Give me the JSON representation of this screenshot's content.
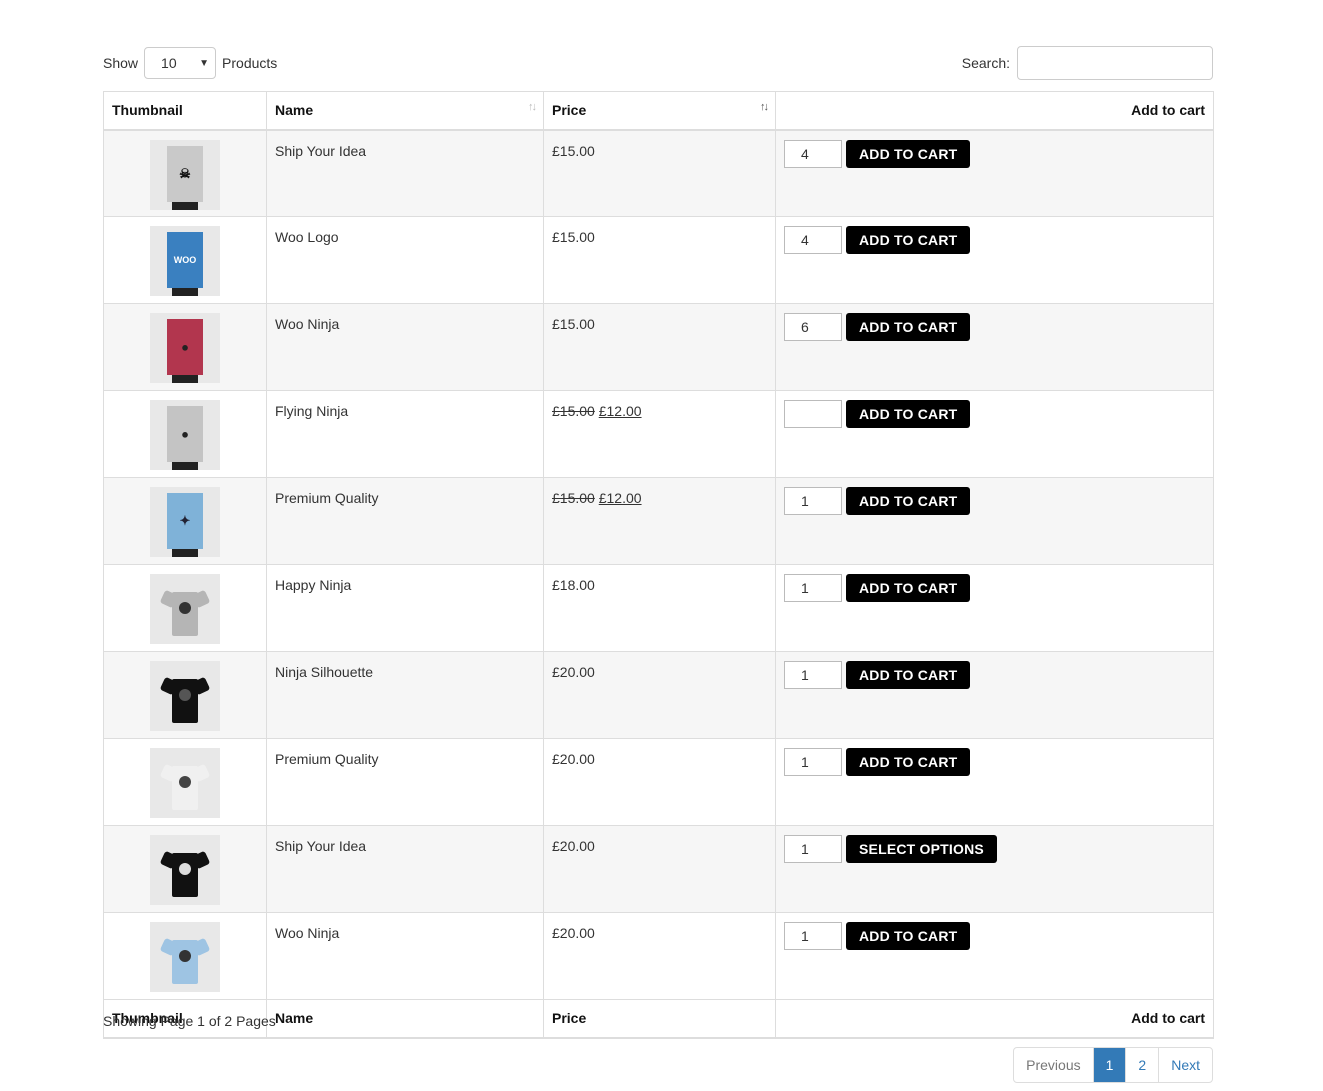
{
  "controls": {
    "show_label": "Show",
    "page_size": "10",
    "products_label": "Products",
    "search_label": "Search:",
    "search_value": ""
  },
  "columns": {
    "thumbnail": "Thumbnail",
    "name": "Name",
    "price": "Price",
    "add_to_cart": "Add to cart"
  },
  "rows": [
    {
      "name": "Ship Your Idea",
      "price": "£15.00",
      "qty": "4",
      "button": "ADD TO CART",
      "thumb": "poster-gray-skull"
    },
    {
      "name": "Woo Logo",
      "price": "£15.00",
      "qty": "4",
      "button": "ADD TO CART",
      "thumb": "poster-blue-woo"
    },
    {
      "name": "Woo Ninja",
      "price": "£15.00",
      "qty": "6",
      "button": "ADD TO CART",
      "thumb": "poster-red-ninja"
    },
    {
      "name": "Flying Ninja",
      "old_price": "£15.00",
      "sale_price": "£12.00",
      "qty": "",
      "button": "ADD TO CART",
      "thumb": "poster-gray-ninja"
    },
    {
      "name": "Premium Quality",
      "old_price": "£15.00",
      "sale_price": "£12.00",
      "qty": "1",
      "button": "ADD TO CART",
      "thumb": "poster-lightblue-badge"
    },
    {
      "name": "Happy Ninja",
      "price": "£18.00",
      "qty": "1",
      "button": "ADD TO CART",
      "thumb": "tshirt-gray"
    },
    {
      "name": "Ninja Silhouette",
      "price": "£20.00",
      "qty": "1",
      "button": "ADD TO CART",
      "thumb": "tshirt-black"
    },
    {
      "name": "Premium Quality",
      "price": "£20.00",
      "qty": "1",
      "button": "ADD TO CART",
      "thumb": "tshirt-white"
    },
    {
      "name": "Ship Your Idea",
      "price": "£20.00",
      "qty": "1",
      "button": "SELECT OPTIONS",
      "thumb": "tshirt-black-skull"
    },
    {
      "name": "Woo Ninja",
      "price": "£20.00",
      "qty": "1",
      "button": "ADD TO CART",
      "thumb": "tshirt-lightblue"
    }
  ],
  "footer": {
    "info": "Showing Page 1 of 2 Pages",
    "previous": "Previous",
    "page1": "1",
    "page2": "2",
    "next": "Next"
  },
  "colors": {
    "accent": "#337ab7",
    "button_bg": "#000000",
    "stripe": "#f6f6f6"
  }
}
